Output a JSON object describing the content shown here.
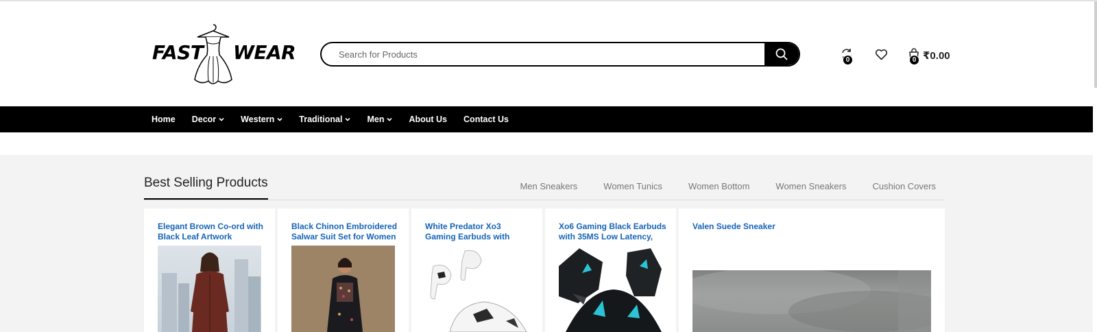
{
  "brand": {
    "word1": "FAST",
    "word2": "WEAR"
  },
  "search": {
    "placeholder": "Search for Products"
  },
  "header": {
    "compare_count": "0",
    "cart_count": "0",
    "cart_total": "₹0.00"
  },
  "nav": {
    "items": [
      {
        "label": "Home"
      },
      {
        "label": "Decor"
      },
      {
        "label": "Western"
      },
      {
        "label": "Traditional"
      },
      {
        "label": "Men"
      },
      {
        "label": "About Us"
      },
      {
        "label": "Contact Us"
      }
    ]
  },
  "section": {
    "title": "Best Selling Products",
    "tabs": [
      "Men Sneakers",
      "Women Tunics",
      "Women Bottom",
      "Women Sneakers",
      "Cushion Covers"
    ]
  },
  "products": [
    {
      "title": "Elegant Brown Co-ord with Black Leaf Artwork"
    },
    {
      "title": "Black Chinon Embroidered Salwar Suit Set for Women"
    },
    {
      "title": "White Predator Xo3 Gaming Earbuds with"
    },
    {
      "title": "Xo6 Gaming Black Earbuds with 35MS Low Latency,"
    },
    {
      "title": "Valen Suede Sneaker"
    }
  ],
  "colors": {
    "accent": "#000000",
    "link": "#1463b8",
    "section_bg": "#f3f3f3",
    "earbud_accent": "#2bc4d6"
  },
  "icons": [
    "search-icon",
    "compare-icon",
    "heart-icon",
    "bag-icon",
    "chevron-down-icon"
  ]
}
